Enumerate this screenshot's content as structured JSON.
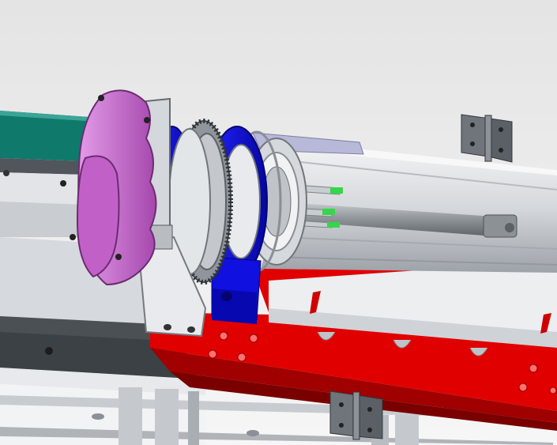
{
  "scene": {
    "subject": "cad-assembly-viewport",
    "colors": {
      "background_top": "#e6e6e6",
      "background_bottom": "#f4f4f4",
      "frame_silver": "#d9dde2",
      "frame_shadow": "#8f959c",
      "rail_dark": "#555b60",
      "base_red": "#e00000",
      "base_red_dark": "#a00000",
      "bearing_blue": "#1010e0",
      "bearing_blue_dark": "#07078a",
      "gear_gray": "#9aa0a6",
      "flange_pink": "#d377d8",
      "flange_pink_dark": "#9b3fa3",
      "belt_teal": "#0f7a6c",
      "hinge_gray": "#6f757b",
      "rod_gray": "#8a8f94",
      "sensor_green": "#35d64a",
      "panel_lilac": "#b8b8d8"
    },
    "icons": [
      "hinge-icon"
    ]
  }
}
